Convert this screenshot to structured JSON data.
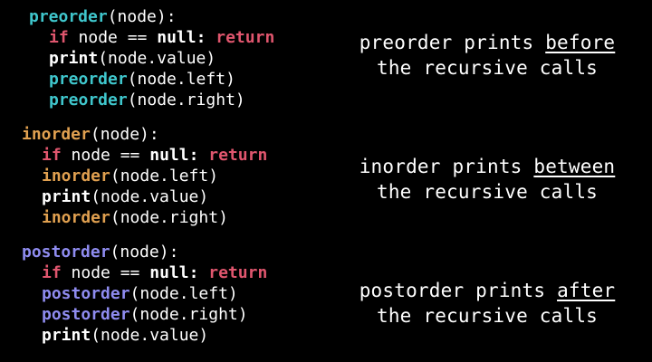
{
  "colors": {
    "background": "#000000",
    "text": "#ffffff",
    "keyword": "#e0566e",
    "preorder": "#3fc6cc",
    "inorder": "#e0a050",
    "postorder": "#8f8cf0"
  },
  "preorder": {
    "name": "preorder",
    "header_args": "(node):",
    "if_kw": "if",
    "cond": " node == ",
    "null_kw": "null:",
    "return_kw": " return",
    "print_fn": "print",
    "print_args": "(node.value)",
    "call_fn": "preorder",
    "left_args": "(node.left)",
    "right_args": "(node.right)",
    "caption_line1_pre": "preorder prints ",
    "caption_line1_em": "before",
    "caption_line2": "the recursive calls"
  },
  "inorder": {
    "name": "inorder",
    "header_args": "(node):",
    "if_kw": "if",
    "cond": " node == ",
    "null_kw": "null:",
    "return_kw": " return",
    "print_fn": "print",
    "print_args": "(node.value)",
    "call_fn": "inorder",
    "left_args": "(node.left)",
    "right_args": "(node.right)",
    "caption_line1_pre": "inorder prints ",
    "caption_line1_em": "between",
    "caption_line2": "the recursive calls"
  },
  "postorder": {
    "name": "postorder",
    "header_args": "(node):",
    "if_kw": "if",
    "cond": " node == ",
    "null_kw": "null:",
    "return_kw": " return",
    "print_fn": "print",
    "print_args": "(node.value)",
    "call_fn": "postorder",
    "left_args": "(node.left)",
    "right_args": "(node.right)",
    "caption_line1_pre": "postorder prints ",
    "caption_line1_em": "after",
    "caption_line2": "the recursive calls"
  }
}
